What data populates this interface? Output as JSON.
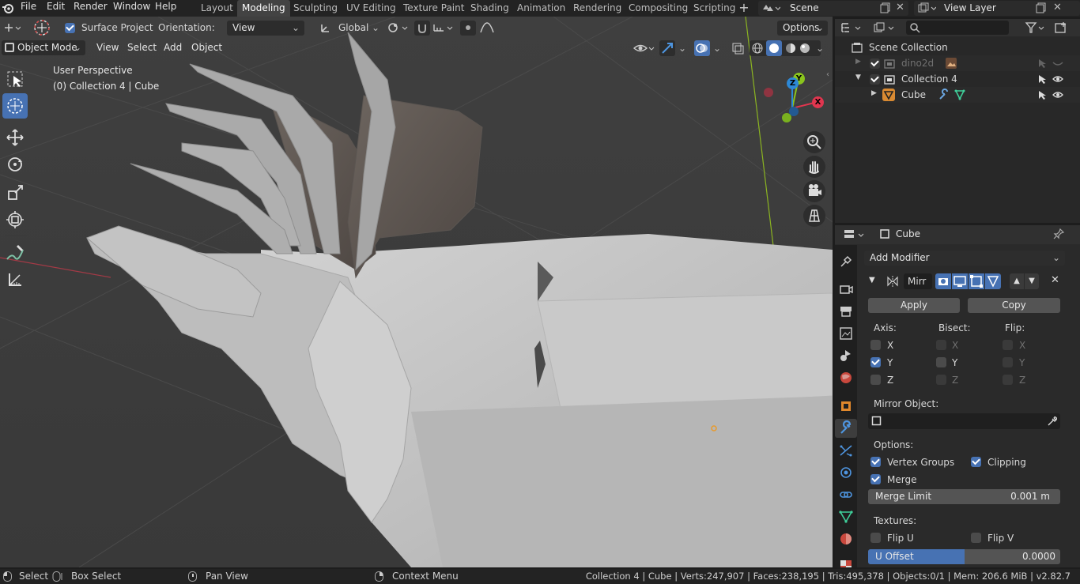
{
  "menubar": {
    "items": [
      "File",
      "Edit",
      "Render",
      "Window",
      "Help"
    ],
    "workspaces": [
      "Layout",
      "Modeling",
      "Sculpting",
      "UV Editing",
      "Texture Paint",
      "Shading",
      "Animation",
      "Rendering",
      "Compositing",
      "Scripting"
    ],
    "active_workspace": "Modeling",
    "scene_label": "Scene",
    "view_layer_label": "View Layer"
  },
  "tool_header": {
    "surface_project_label": "Surface Project",
    "orientation_label": "Orientation:",
    "orientation_value": "View",
    "transform_orientation": "Global",
    "options_label": "Options"
  },
  "viewport_header": {
    "mode": "Object Mode",
    "menus": [
      "View",
      "Select",
      "Add",
      "Object"
    ]
  },
  "viewport": {
    "perspective_label": "User Perspective",
    "collection_label": "(0) Collection 4 | Cube",
    "gizmo": {
      "x": "X",
      "y": "Y",
      "z": "Z"
    }
  },
  "outliner": {
    "scene_collection": "Scene Collection",
    "items": [
      {
        "name": "dino2d",
        "dimmed": true
      },
      {
        "name": "Collection 4",
        "dimmed": false
      },
      {
        "name": "Cube",
        "dimmed": false
      }
    ]
  },
  "properties": {
    "object_name": "Cube",
    "add_modifier": "Add Modifier",
    "modifier_name": "Mirr",
    "apply_label": "Apply",
    "copy_label": "Copy",
    "axis_label": "Axis:",
    "bisect_label": "Bisect:",
    "flip_label": "Flip:",
    "axes": [
      "X",
      "Y",
      "Z"
    ],
    "axis_checked": [
      false,
      true,
      false
    ],
    "bisect_checked": [
      false,
      false,
      false
    ],
    "flip_checked": [
      false,
      false,
      false
    ],
    "mirror_object_label": "Mirror Object:",
    "options_label": "Options:",
    "vertex_groups_label": "Vertex Groups",
    "clipping_label": "Clipping",
    "merge_label": "Merge",
    "merge_limit_label": "Merge Limit",
    "merge_limit_value": "0.001 m",
    "textures_label": "Textures:",
    "flip_u_label": "Flip U",
    "flip_v_label": "Flip V",
    "u_offset_label": "U Offset",
    "u_offset_value": "0.0000",
    "u_offset_fill": 0.5
  },
  "statusbar": {
    "select": "Select",
    "box_select": "Box Select",
    "pan_view": "Pan View",
    "context_menu": "Context Menu",
    "stats": "Collection 4 | Cube | Verts:247,907 | Faces:238,195 | Tris:495,378 | Objects:0/1 | Mem: 206.6 MiB | v2.82.7"
  },
  "colors": {
    "accent": "#4772b3",
    "axis_x": "#e0364f",
    "axis_y": "#8ac41d",
    "axis_z": "#2d88d6"
  }
}
